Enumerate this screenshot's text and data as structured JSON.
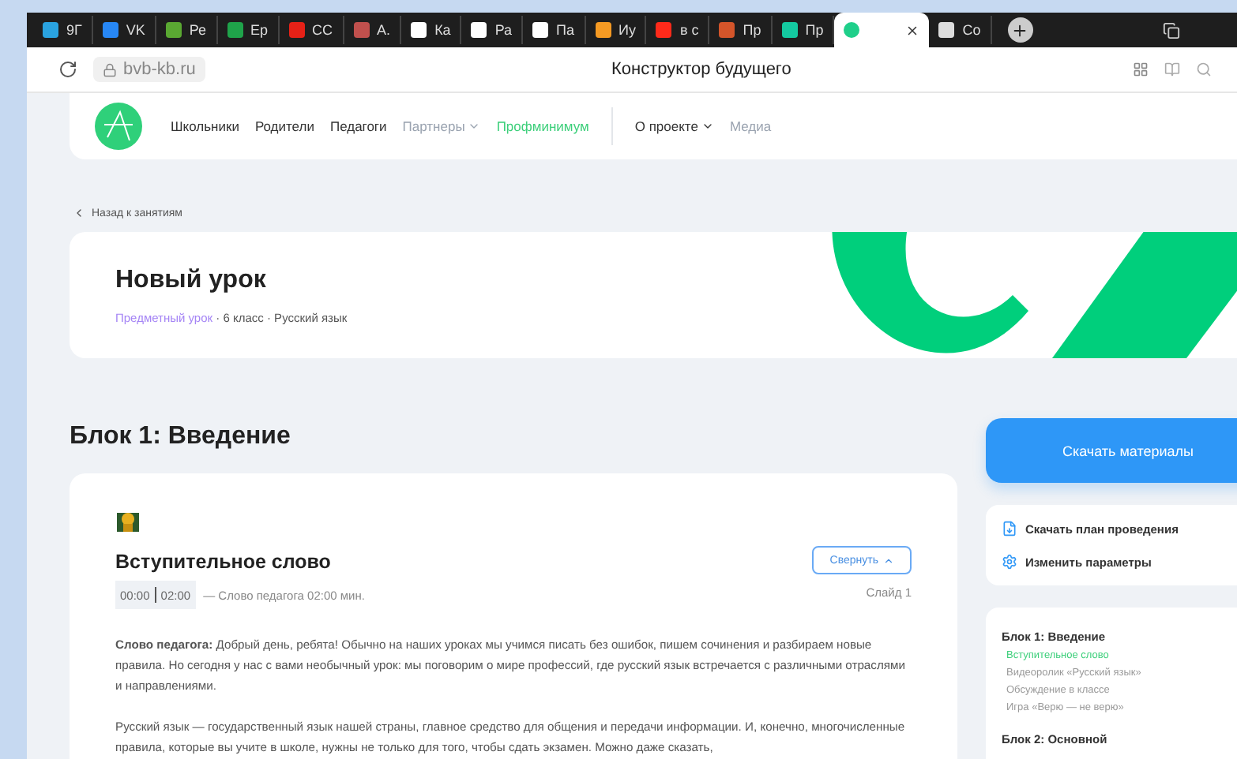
{
  "browser": {
    "tabs": [
      {
        "label": "9Г",
        "color": "#2aa3e0",
        "selected": false
      },
      {
        "label": "VK",
        "color": "#2787f5",
        "selected": false
      },
      {
        "label": "Ре",
        "color": "#5aa832",
        "selected": false
      },
      {
        "label": "Ер",
        "color": "#1fa34a",
        "selected": false
      },
      {
        "label": "СС",
        "color": "#e62117",
        "selected": false
      },
      {
        "label": "А.",
        "color": "#c0504d",
        "selected": false
      },
      {
        "label": "Ка",
        "color": "#ffffff",
        "selected": false
      },
      {
        "label": "Ра",
        "color": "#ffffff",
        "selected": false
      },
      {
        "label": "Па",
        "color": "#ffffff",
        "selected": false
      },
      {
        "label": "Иу",
        "color": "#f59a23",
        "selected": false
      },
      {
        "label": "в с",
        "color": "#ff2a1a",
        "selected": false
      },
      {
        "label": "Пр",
        "color": "#d4552a",
        "selected": false
      },
      {
        "label": "Пр",
        "color": "#14c9a0",
        "selected": false
      },
      {
        "color": "#1fcf8a",
        "selected": true
      },
      {
        "label": "Co",
        "color": "#dddddd",
        "selected": false
      }
    ],
    "address": "bvb-kb.ru",
    "page_title": "Конструктор будущего"
  },
  "nav": {
    "primary": [
      {
        "label": "Школьники",
        "color": "#333333",
        "dropdown": false
      },
      {
        "label": "Родители",
        "color": "#333333",
        "dropdown": false
      },
      {
        "label": "Педагоги",
        "color": "#333333",
        "dropdown": false
      },
      {
        "label": "Партнеры",
        "color": "#9aa3b0",
        "dropdown": true
      },
      {
        "label": "Профминимум",
        "color": "#3ccf7a",
        "dropdown": false
      }
    ],
    "secondary": [
      {
        "label": "О проекте",
        "color": "#333333",
        "dropdown": true
      },
      {
        "label": "Медиа",
        "color": "#9aa3b0",
        "dropdown": false
      }
    ]
  },
  "back_link": "Назад к занятиям",
  "hero": {
    "title": "Новый урок",
    "type": "Предметный урок",
    "meta": " · 6 класс · Русский язык"
  },
  "block_title": "Блок 1: Введение",
  "step": {
    "title": "Вступительное слово",
    "collapse_button": "Свернуть",
    "time_start": "00:00",
    "time_end": "02:00",
    "description": "— Слово педагога 02:00 мин.",
    "slide": "Слайд 1",
    "paragraphs": [
      "**Слово педагога:** Добрый день, ребята! Обычно на наших уроках мы учимся писать без ошибок, пишем сочинения и разбираем новые правила. Но сегодня у нас с вами необычный урок: мы поговорим о мире профессий, где русский язык встречается с различными отраслями и направлениями.",
      "Русский язык — государственный язык нашей страны, главное средство для общения и передачи информации. И, конечно, многочисленные правила, которые вы учите в школе, нужны не только для того, чтобы сдать экзамен. Можно даже сказать,"
    ]
  },
  "sidebar": {
    "download_button": "Скачать материалы",
    "actions": [
      {
        "label": "Скачать план проведения",
        "kind": "file"
      },
      {
        "label": "Изменить параметры",
        "kind": "settings"
      }
    ],
    "outline": [
      {
        "title": "Блок 1: Введение",
        "items": [
          {
            "label": "Вступительное слово",
            "selected": true
          },
          {
            "label": "Видеоролик «Русский язык»",
            "selected": false
          },
          {
            "label": "Обсуждение в классе",
            "selected": false
          },
          {
            "label": "Игра «Верю — не верю»",
            "selected": false
          }
        ]
      },
      {
        "title": "Блок 2: Основной"
      }
    ]
  }
}
